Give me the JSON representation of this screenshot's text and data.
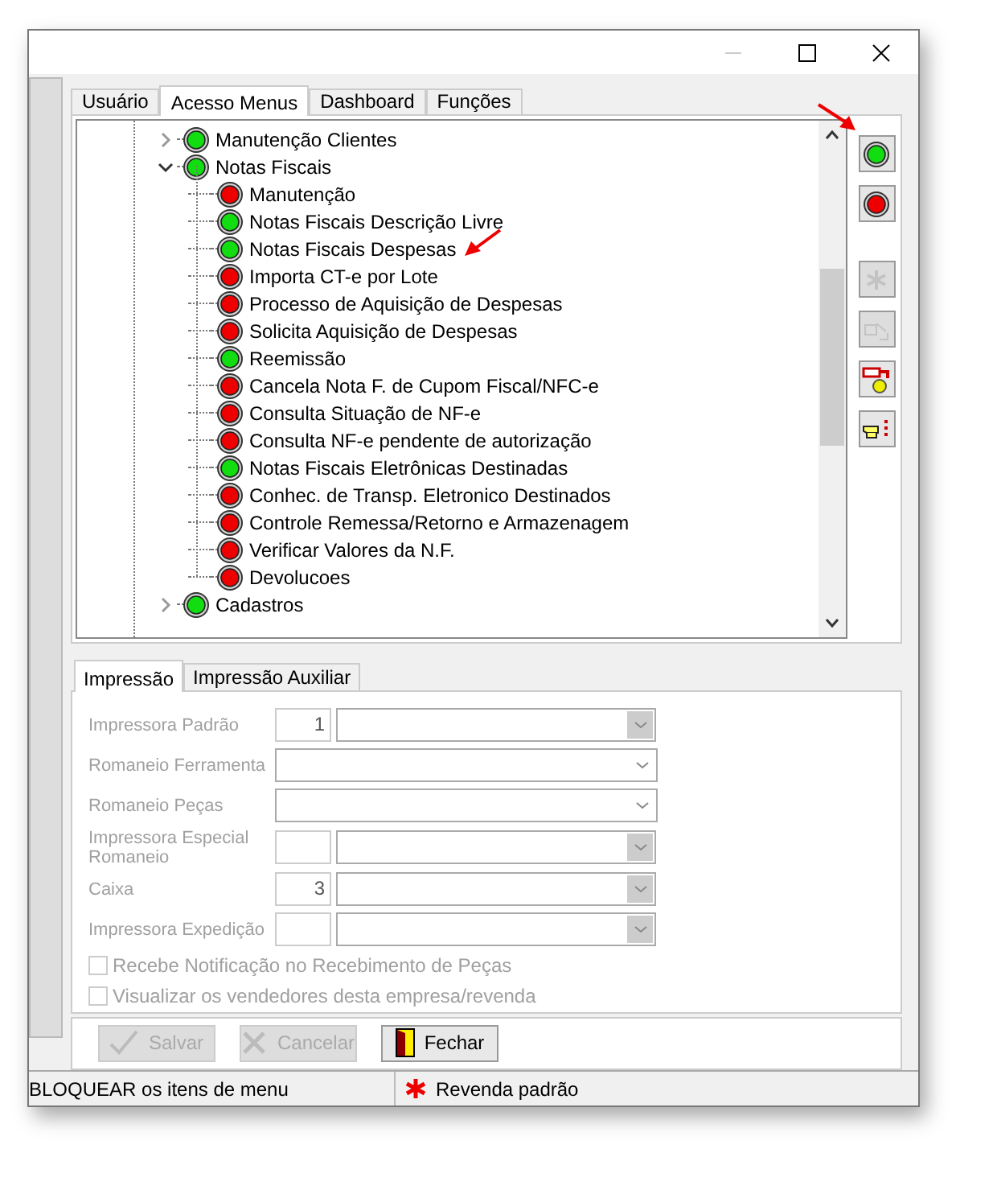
{
  "tabs": [
    {
      "label": "Usuário",
      "selected": false
    },
    {
      "label": "Acesso Menus",
      "selected": true
    },
    {
      "label": "Dashboard",
      "selected": false
    },
    {
      "label": "Funções",
      "selected": false
    }
  ],
  "tree": [
    {
      "label": "Manutenção Clientes",
      "on": true,
      "expanded": false
    },
    {
      "label": "Notas Fiscais",
      "on": true,
      "expanded": true,
      "children": [
        {
          "label": "Manutenção",
          "on": false
        },
        {
          "label": "Notas Fiscais Descrição Livre",
          "on": true
        },
        {
          "label": "Notas Fiscais Despesas",
          "on": true
        },
        {
          "label": "Importa CT-e por Lote",
          "on": false
        },
        {
          "label": "Processo de Aquisição de Despesas",
          "on": false
        },
        {
          "label": "Solicita Aquisição de Despesas",
          "on": false
        },
        {
          "label": "Reemissão",
          "on": true
        },
        {
          "label": "Cancela Nota F. de Cupom Fiscal/NFC-e",
          "on": false
        },
        {
          "label": "Consulta Situação de NF-e",
          "on": false
        },
        {
          "label": "Consulta NF-e pendente de autorização",
          "on": false
        },
        {
          "label": "Notas Fiscais Eletrônicas Destinadas",
          "on": true
        },
        {
          "label": "Conhec. de Transp. Eletronico Destinados",
          "on": false
        },
        {
          "label": "Controle Remessa/Retorno e Armazenagem",
          "on": false
        },
        {
          "label": "Verificar Valores da N.F.",
          "on": false
        },
        {
          "label": "Devolucoes",
          "on": false
        }
      ]
    },
    {
      "label": "Cadastros",
      "on": true,
      "expanded": false
    }
  ],
  "toolbar": [
    {
      "kind": "allow",
      "disabled": false
    },
    {
      "kind": "block",
      "disabled": false
    },
    {
      "kind": "clear",
      "disabled": true
    },
    {
      "kind": "copy",
      "disabled": true
    },
    {
      "kind": "transfer",
      "disabled": false
    },
    {
      "kind": "point",
      "disabled": false
    }
  ],
  "sub_tabs": [
    {
      "label": "Impressão",
      "selected": true
    },
    {
      "label": "Impressão Auxiliar",
      "selected": false
    }
  ],
  "fields": [
    {
      "kind": "code_select",
      "label": "Impressora Padrão",
      "value": "1"
    },
    {
      "kind": "select",
      "label": "Romaneio Ferramenta"
    },
    {
      "kind": "select",
      "label": "Romaneio Peças"
    },
    {
      "kind": "code_select",
      "label": "Impressora Especial Romaneio"
    },
    {
      "kind": "code_select",
      "label": "Caixa",
      "value": "3"
    },
    {
      "kind": "code_select",
      "label": "Impressora Expedição"
    }
  ],
  "checkboxes": [
    {
      "label": "Recebe Notificação no Recebimento de Peças",
      "checked": false
    },
    {
      "label": "Visualizar os vendedores desta empresa/revenda",
      "checked": false
    }
  ],
  "buttons": [
    {
      "kind": "save",
      "label": "Salvar",
      "disabled": true
    },
    {
      "kind": "cancel",
      "label": "Cancelar",
      "disabled": true
    },
    {
      "kind": "close",
      "label": "Fechar",
      "disabled": false
    }
  ],
  "status_bar": [
    {
      "kind": "text",
      "text": "BLOQUEAR os itens de menu"
    },
    {
      "kind": "star",
      "text": "Revenda padrão"
    }
  ]
}
